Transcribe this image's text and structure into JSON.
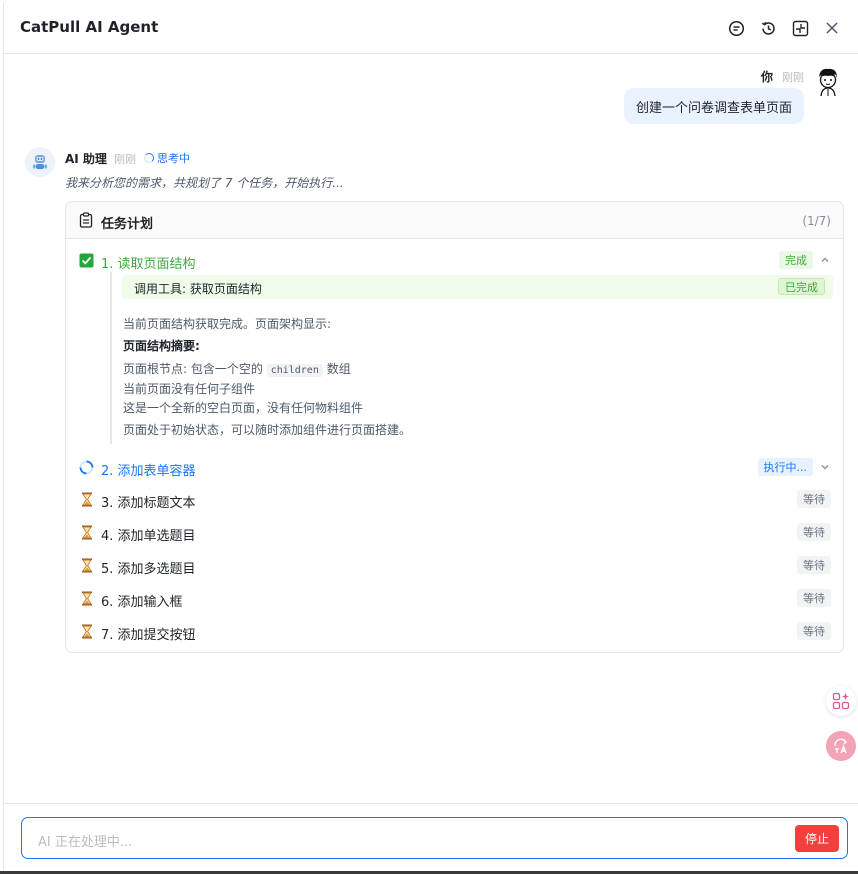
{
  "header": {
    "title": "CatPull AI Agent"
  },
  "user_message": {
    "name": "你",
    "time": "刚刚",
    "text": "创建一个问卷调查表单页面"
  },
  "ai_message": {
    "name": "AI 助理",
    "time": "刚刚",
    "status": "思考中",
    "intro": "我来分析您的需求，共规划了 7 个任务，开始执行..."
  },
  "plan": {
    "title": "任务计划",
    "count": "(1/7)",
    "tasks": [
      {
        "label": "1. 读取页面结构",
        "status": "完成",
        "state": "done"
      },
      {
        "label": "2. 添加表单容器",
        "status": "执行中...",
        "state": "running"
      },
      {
        "label": "3. 添加标题文本",
        "status": "等待",
        "state": "waiting"
      },
      {
        "label": "4. 添加单选题目",
        "status": "等待",
        "state": "waiting"
      },
      {
        "label": "5. 添加多选题目",
        "status": "等待",
        "state": "waiting"
      },
      {
        "label": "6. 添加输入框",
        "status": "等待",
        "state": "waiting"
      },
      {
        "label": "7. 添加提交按钮",
        "status": "等待",
        "state": "waiting"
      }
    ],
    "detail": {
      "tool_call": "调用工具: 获取页面结构",
      "tool_status": "已完成",
      "line1": "当前页面结构获取完成。页面架构显示:",
      "summary_title": "页面结构摘要:",
      "bullet1_pre": "页面根节点: 包含一个空的",
      "bullet1_code": "children",
      "bullet1_post": "数组",
      "bullet2": "当前页面没有任何子组件",
      "bullet3": "这是一个全新的空白页面，没有任何物料组件",
      "line_end": "页面处于初始状态，可以随时添加组件进行页面搭建。"
    }
  },
  "input": {
    "placeholder": "AI 正在处理中...",
    "stop_label": "停止"
  },
  "colors": {
    "accent": "#1677ff",
    "success": "#3dab3d",
    "danger": "#f53f3f"
  }
}
